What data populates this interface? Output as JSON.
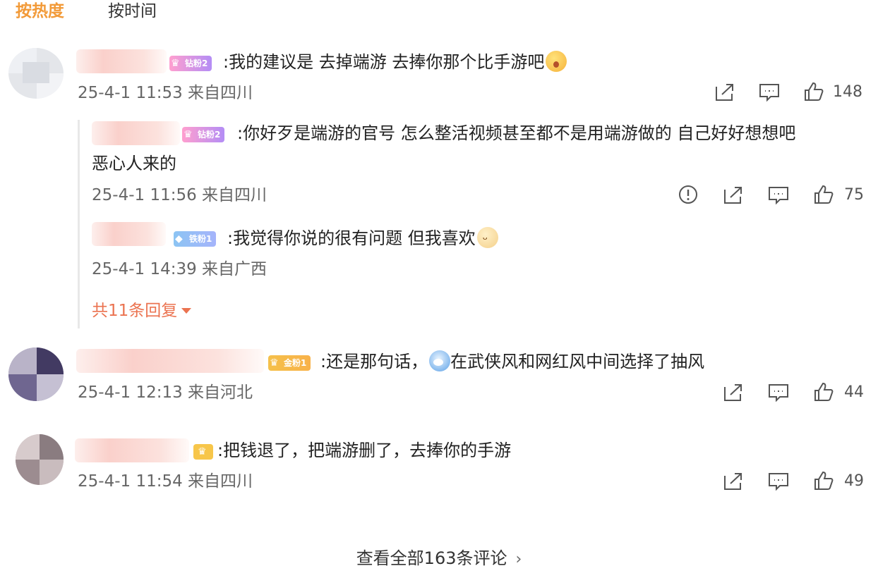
{
  "tabs": {
    "hot": "按热度",
    "time": "按时间"
  },
  "comments": [
    {
      "badge": "钻粉2",
      "text": ":我的建议是 去掉端游 去捧你那个比手游吧",
      "meta": "25-4-1 11:53 来自四川",
      "likes": "148",
      "replies": [
        {
          "badge": "钻粉2",
          "text": ":你好歹是端游的官号 怎么整活视频甚至都不是用端游做的 自己好好想想吧",
          "text2": "恶心人来的",
          "meta": "25-4-1 11:56 来自四川",
          "likes": "75"
        },
        {
          "badge": "铁粉1",
          "text": ":我觉得你说的很有问题 但我喜欢",
          "meta": "25-4-1 14:39 来自广西"
        }
      ],
      "more_replies": "共11条回复"
    },
    {
      "badge": "金粉1",
      "text": ":还是那句话，",
      "text_after": "在武侠风和网红风中间选择了抽风",
      "meta": "25-4-1 12:13 来自河北",
      "likes": "44"
    },
    {
      "text": ":把钱退了，把端游删了，去捧你的手游",
      "meta": "25-4-1 11:54 来自四川",
      "likes": "49"
    }
  ],
  "view_all": "查看全部163条评论"
}
